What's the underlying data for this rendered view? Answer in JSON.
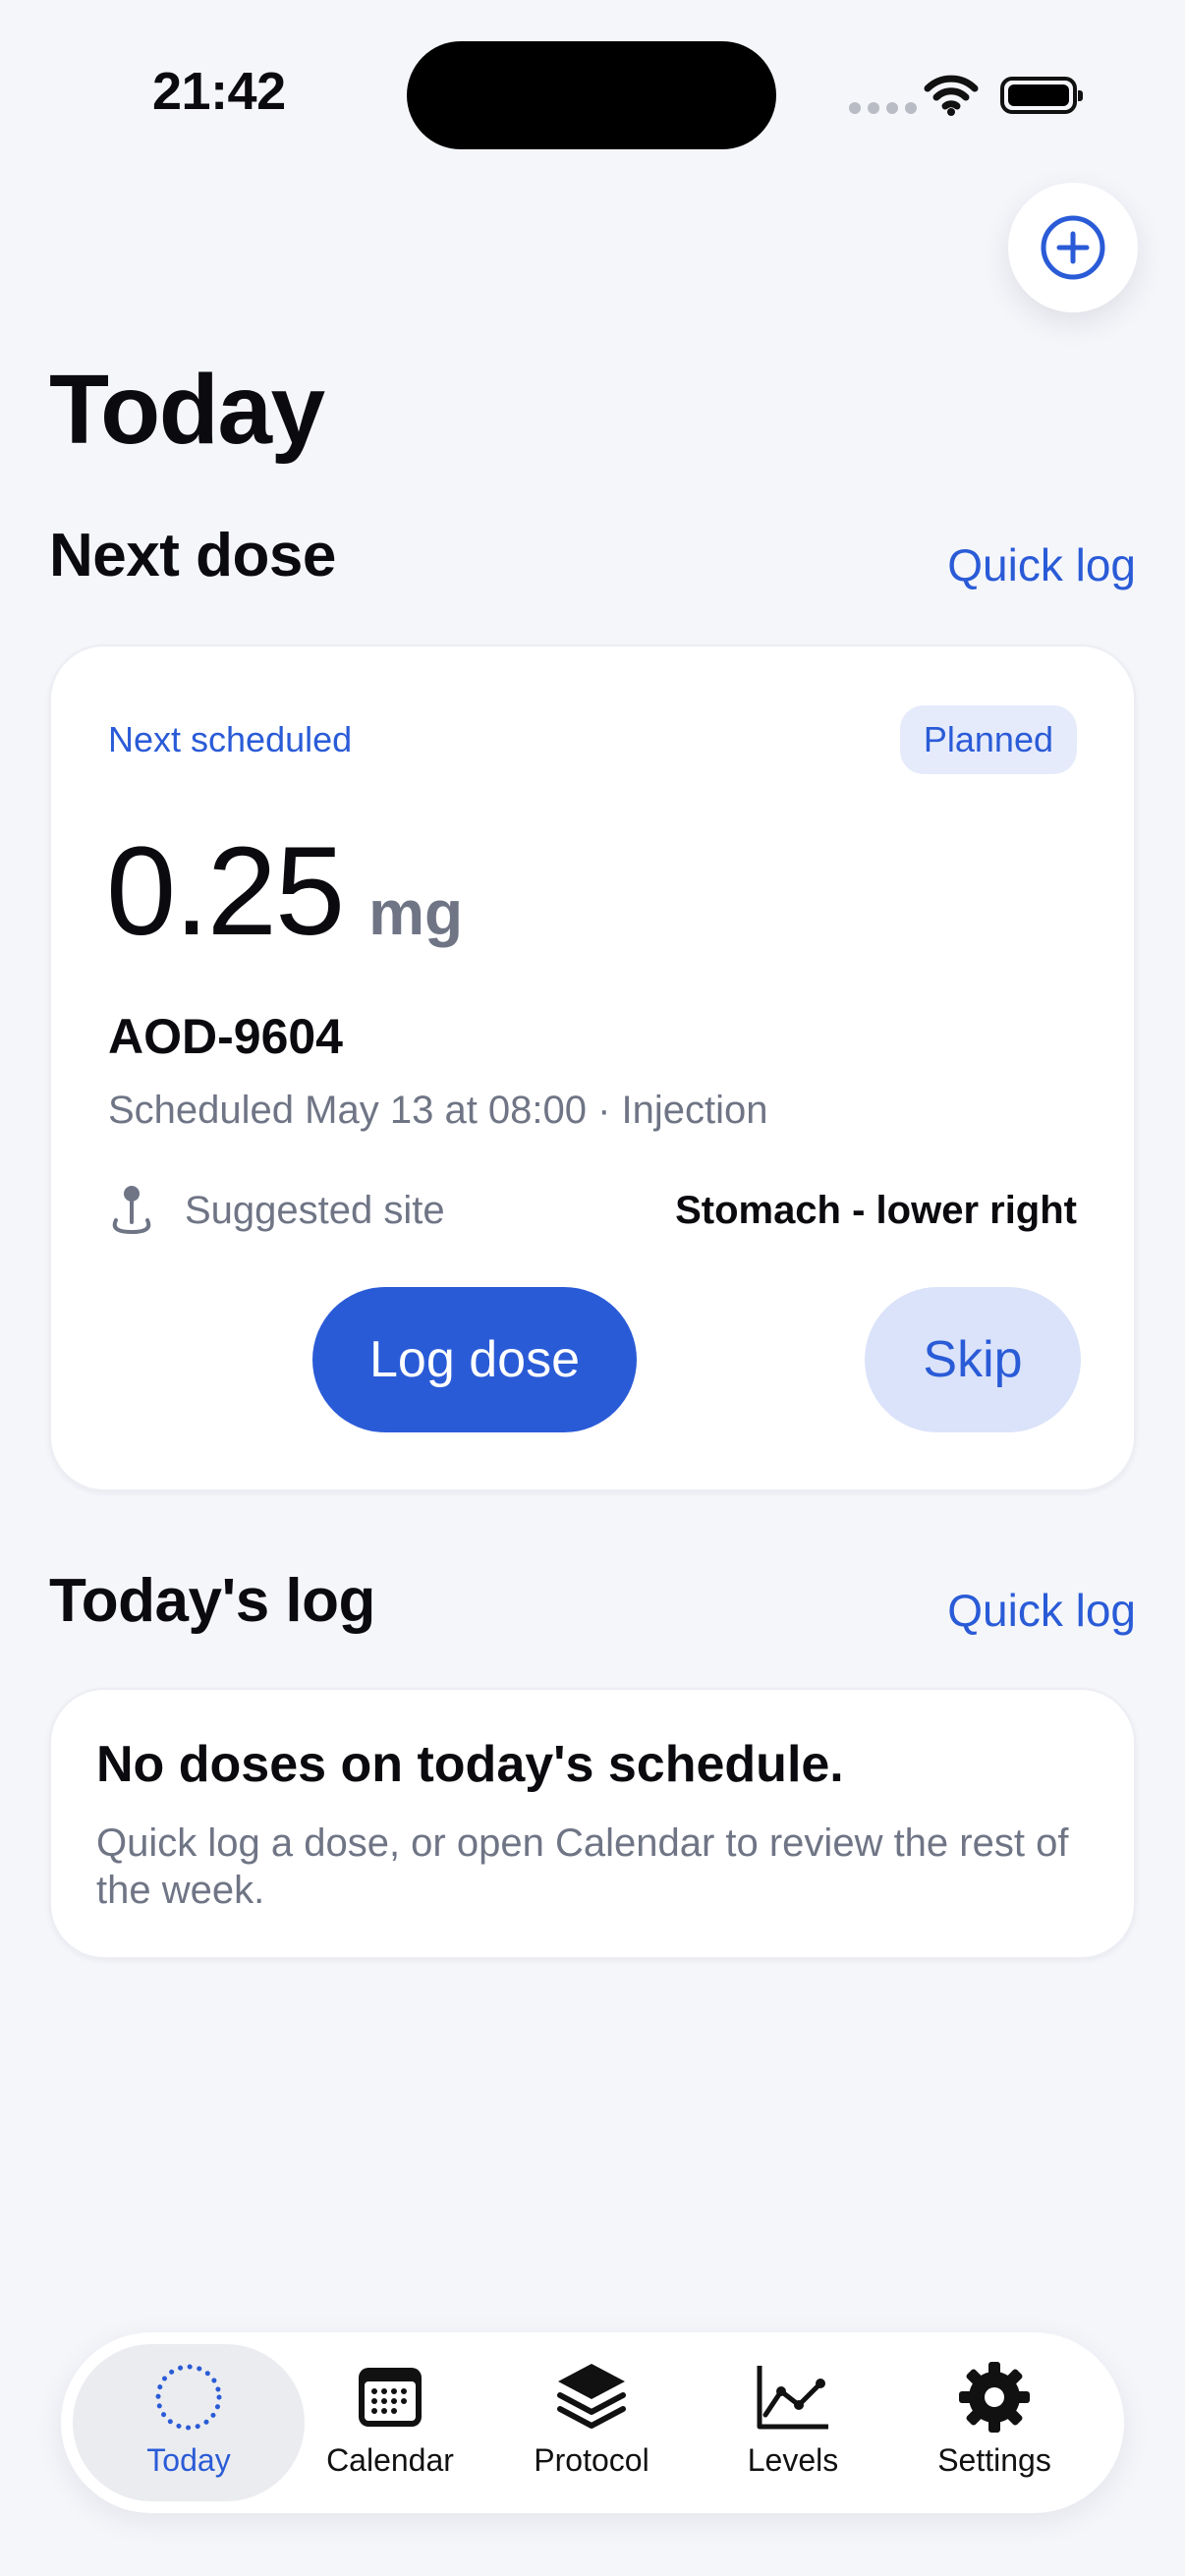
{
  "status_bar": {
    "time": "21:42"
  },
  "header": {
    "title": "Today"
  },
  "next_dose": {
    "section_title": "Next dose",
    "quick_log": "Quick log",
    "card": {
      "label": "Next scheduled",
      "badge": "Planned",
      "amount": "0.25",
      "unit": "mg",
      "drug": "AOD-9604",
      "schedule": "Scheduled May 13 at 08:00 · Injection",
      "site_label": "Suggested site",
      "site_value": "Stomach - lower right",
      "primary_button": "Log dose",
      "secondary_button": "Skip"
    }
  },
  "todays_log": {
    "section_title": "Today's log",
    "quick_log": "Quick log",
    "empty_title": "No doses on today's schedule.",
    "empty_description": "Quick log a dose, or open Calendar to review the rest of the week."
  },
  "tabbar": {
    "active": "Today",
    "tabs": [
      {
        "label": "Today",
        "icon": "dotted-circle-icon"
      },
      {
        "label": "Calendar",
        "icon": "calendar-icon"
      },
      {
        "label": "Protocol",
        "icon": "layers-icon"
      },
      {
        "label": "Levels",
        "icon": "chart-line-icon"
      },
      {
        "label": "Settings",
        "icon": "gear-icon"
      }
    ]
  },
  "colors": {
    "accent": "#2a5bd7",
    "background": "#f5f6fa",
    "muted_text": "#6f7585"
  }
}
